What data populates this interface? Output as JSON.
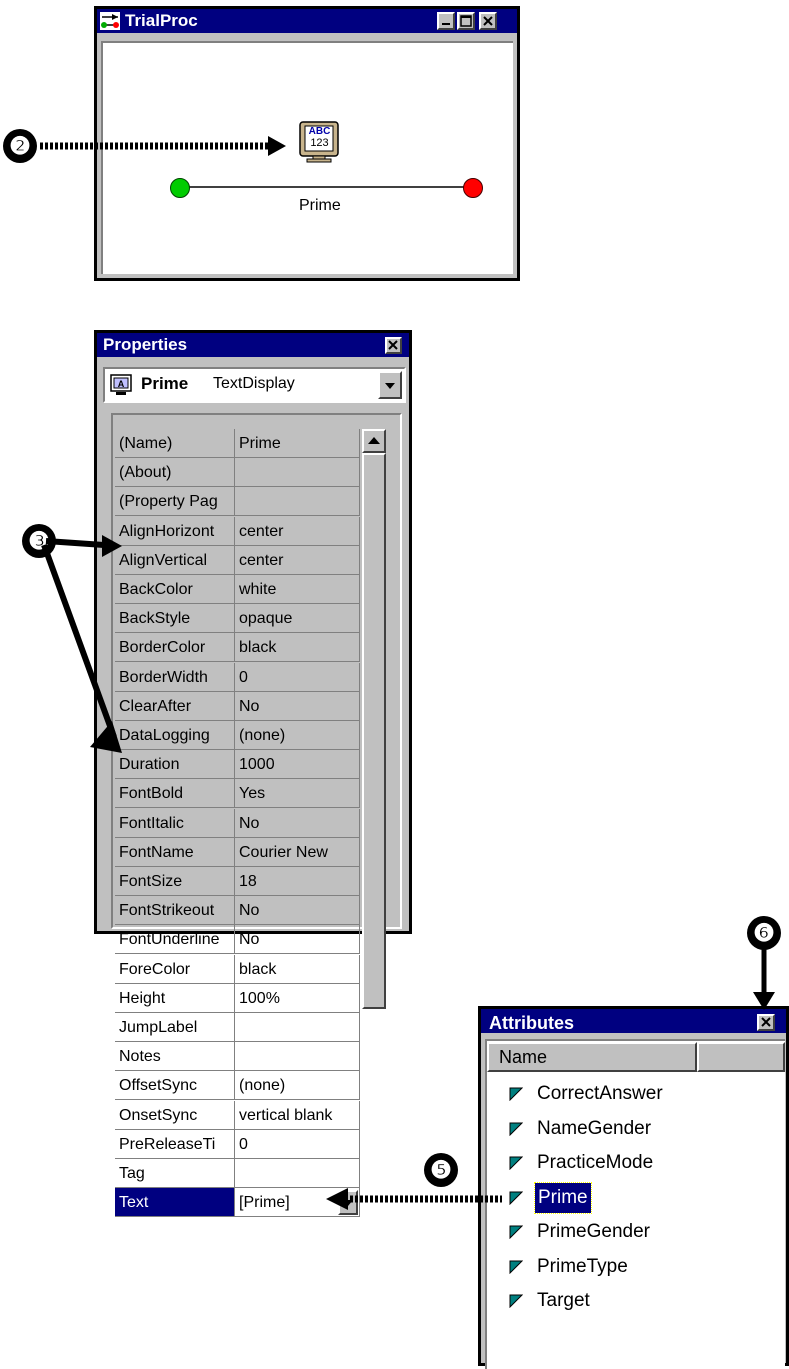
{
  "trialproc": {
    "title": "TrialProc",
    "node_label": "Prime",
    "node_icon_text_top": "ABC",
    "node_icon_text_bottom": "123"
  },
  "properties": {
    "title": "Properties",
    "object_name": "Prime",
    "object_type": "TextDisplay",
    "rows": [
      {
        "name": "(Name)",
        "value": "Prime"
      },
      {
        "name": "(About)",
        "value": ""
      },
      {
        "name": "(Property Pag",
        "value": ""
      },
      {
        "name": "AlignHorizont",
        "value": "center"
      },
      {
        "name": "AlignVertical",
        "value": "center"
      },
      {
        "name": "BackColor",
        "value": "white"
      },
      {
        "name": "BackStyle",
        "value": "opaque"
      },
      {
        "name": "BorderColor",
        "value": "black"
      },
      {
        "name": "BorderWidth",
        "value": "0"
      },
      {
        "name": "ClearAfter",
        "value": "No"
      },
      {
        "name": "DataLogging",
        "value": "(none)"
      },
      {
        "name": "Duration",
        "value": "1000"
      },
      {
        "name": "FontBold",
        "value": "Yes"
      },
      {
        "name": "FontItalic",
        "value": "No"
      },
      {
        "name": "FontName",
        "value": "Courier New"
      },
      {
        "name": "FontSize",
        "value": "18"
      },
      {
        "name": "FontStrikeout",
        "value": "No"
      },
      {
        "name": "FontUnderline",
        "value": "No"
      },
      {
        "name": "ForeColor",
        "value": "black"
      },
      {
        "name": "Height",
        "value": "100%"
      },
      {
        "name": "JumpLabel",
        "value": ""
      },
      {
        "name": "Notes",
        "value": ""
      },
      {
        "name": "OffsetSync",
        "value": "(none)"
      },
      {
        "name": "OnsetSync",
        "value": "vertical blank"
      },
      {
        "name": "PreReleaseTi",
        "value": "0"
      },
      {
        "name": "Tag",
        "value": ""
      },
      {
        "name": "Text",
        "value": "[Prime]"
      }
    ]
  },
  "attributes": {
    "title": "Attributes",
    "column_name": "Name",
    "items": [
      "CorrectAnswer",
      "NameGender",
      "PracticeMode",
      "Prime",
      "PrimeGender",
      "PrimeType",
      "Target"
    ]
  },
  "callouts": {
    "c2": "❷",
    "c3": "❸",
    "c5": "❺",
    "c6": "❻"
  },
  "colors": {
    "titlebar": "#000080",
    "start_node": "#00cc00",
    "end_node": "#ff0000",
    "attr_icon": "#008080"
  }
}
